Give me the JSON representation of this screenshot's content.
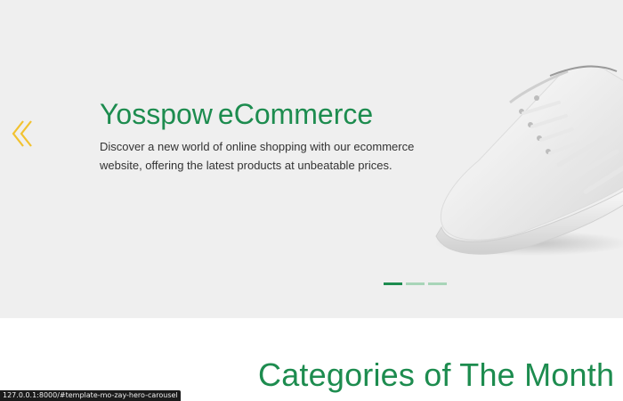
{
  "hero": {
    "title_brand": "Yosspow",
    "title_sub": "eCommerce",
    "description": "Discover a new world of online shopping with our ecommerce website, offering the latest products at unbeatable prices.",
    "prev_icon": "chevron-left-icon",
    "image_subject": "white-sneaker",
    "slide_count": 3,
    "active_slide": 1
  },
  "categories": {
    "title": "Categories of The Month"
  },
  "status_bar": {
    "url": "127.0.0.1:8000/#template-mo-zay-hero-carousel"
  },
  "colors": {
    "brand_green": "#1d8c4f",
    "indicator_inactive": "#a8d5b8",
    "arrow_yellow": "#f2c230",
    "hero_background": "#efefef"
  }
}
